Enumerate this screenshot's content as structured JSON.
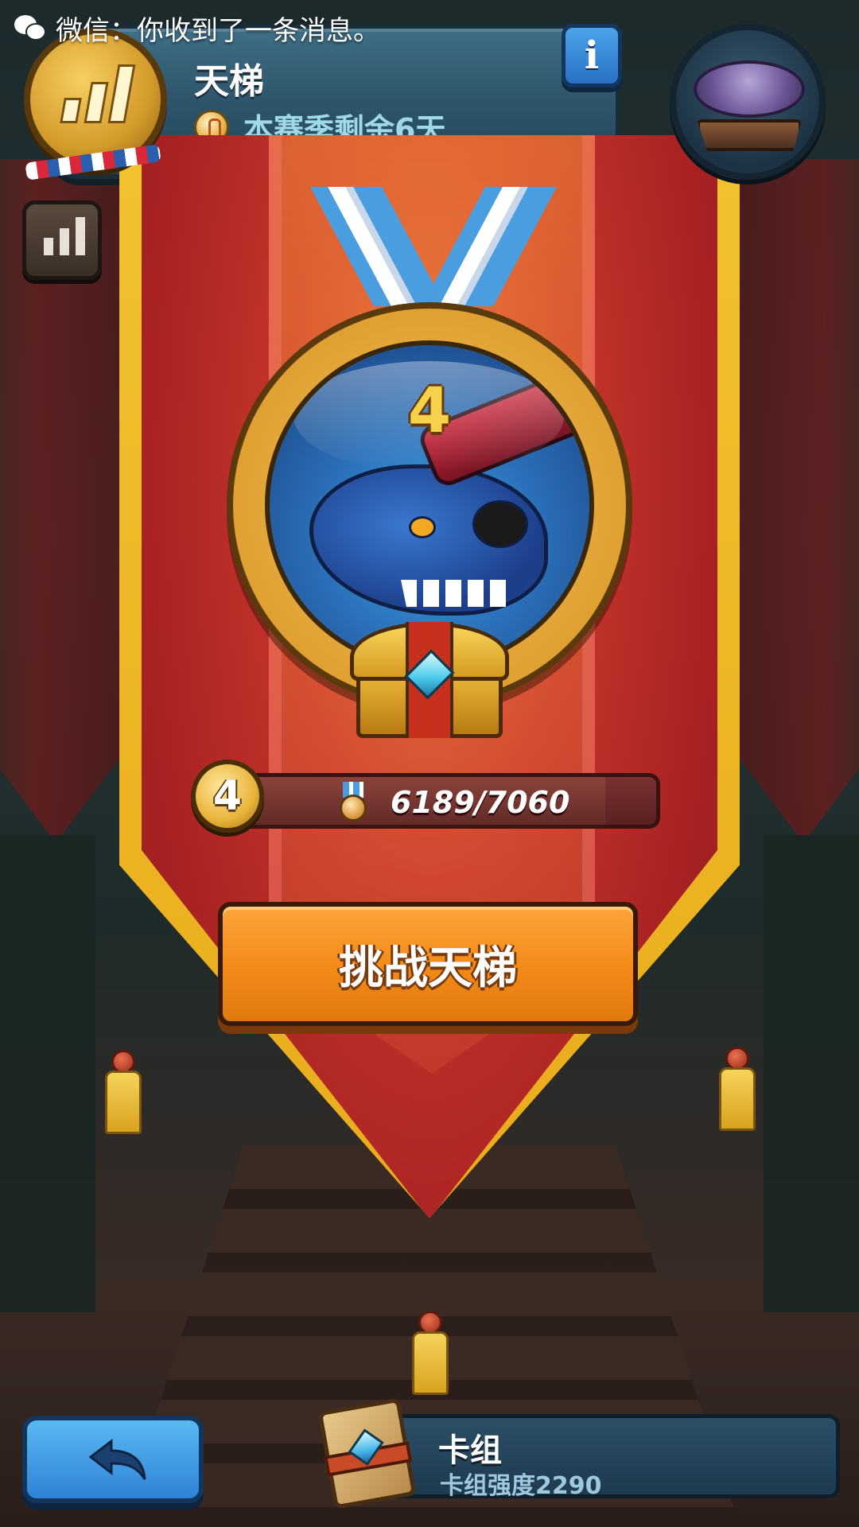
{
  "status_bar": {
    "notification": "微信：你收到了一条消息。",
    "app_icon": "wechat-icon"
  },
  "header": {
    "title": "天梯",
    "season_remaining": "本赛季剩余6天",
    "badge_icon": "ladder-rank-badge-icon",
    "info_icon": "info-icon",
    "info_glyph": "i",
    "airship_icon": "airship-icon"
  },
  "side": {
    "rank_icon": "leaderboard-icon"
  },
  "medal": {
    "rank_number": "4",
    "portrait": "blue-pirate-monster-portrait",
    "chest_icon": "treasure-chest-icon"
  },
  "progress": {
    "level": "4",
    "value_text": "6189/7060",
    "current": 6189,
    "max": 7060,
    "icon": "medal-icon"
  },
  "challenge_button": {
    "label": "挑战天梯"
  },
  "bottom": {
    "back_icon": "back-arrow-icon",
    "deck_title": "卡组",
    "deck_power": "卡组强度2290",
    "deck_icon": "card-deck-book-icon"
  },
  "colors": {
    "banner_red": "#a82222",
    "banner_gold": "#f2c230",
    "button_orange": "#f18a18",
    "back_blue": "#2f82d6",
    "panel_blue": "#2d556b"
  }
}
